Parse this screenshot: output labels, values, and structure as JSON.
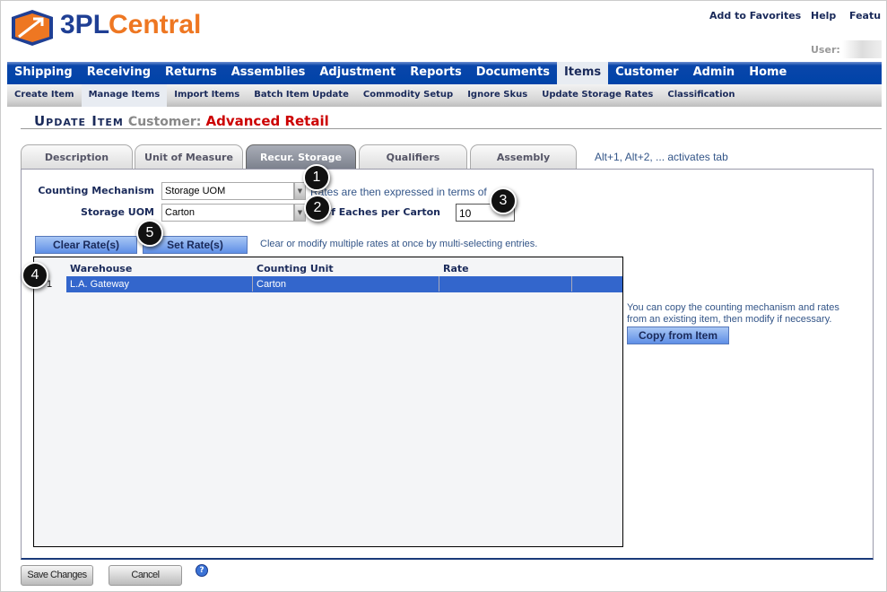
{
  "logo": {
    "text_a": "3PL",
    "text_b": "Central",
    "colors": {
      "blue": "#1f3f94",
      "orange": "#ee7722"
    }
  },
  "top_links": [
    "Add to Favorites",
    "Help",
    "Featu"
  ],
  "user_label": "User:",
  "nav": {
    "items": [
      "Shipping",
      "Receiving",
      "Returns",
      "Assemblies",
      "Adjustment",
      "Reports",
      "Documents",
      "Items",
      "Customer",
      "Admin",
      "Home"
    ],
    "active": "Items"
  },
  "subnav": {
    "items": [
      "Create Item",
      "Manage Items",
      "Import Items",
      "Batch Item Update",
      "Commodity Setup",
      "Ignore Skus",
      "Update Storage Rates",
      "Classification"
    ],
    "active": "Manage Items"
  },
  "page": {
    "title": "Update Item",
    "customer_label": "Customer:",
    "customer": "Advanced Retail"
  },
  "tabs": {
    "items": [
      "Description",
      "Unit of Measure",
      "Recur. Storage",
      "Qualifiers",
      "Assembly"
    ],
    "active": "Recur. Storage",
    "hint": "Alt+1, Alt+2, ... activates tab"
  },
  "form": {
    "counting_mechanism_label": "Counting Mechanism",
    "counting_mechanism_value": "Storage UOM",
    "rates_note": "Rates are then expressed in terms of",
    "storage_uom_label": "Storage UOM",
    "storage_uom_value": "Carton",
    "eaches_label": "# of Eaches per Carton",
    "eaches_value": "10"
  },
  "buttons": {
    "clear_rates": "Clear Rate(s)",
    "set_rates": "Set Rate(s)",
    "multi_hint": "Clear or modify multiple rates at once by multi-selecting entries.",
    "copy_hint_1": "You can copy the counting mechanism and rates",
    "copy_hint_2": "from an existing item, then modify if necessary.",
    "copy_from_item": "Copy from Item",
    "save": "Save Changes",
    "cancel": "Cancel"
  },
  "grid": {
    "headers": [
      "Warehouse",
      "Counting Unit",
      "Rate"
    ],
    "rows": [
      {
        "num": "1",
        "warehouse": "L.A. Gateway",
        "counting_unit": "Carton",
        "rate": ""
      }
    ],
    "selected_color": "#3366cc"
  },
  "callouts": [
    "1",
    "2",
    "3",
    "4",
    "5"
  ]
}
